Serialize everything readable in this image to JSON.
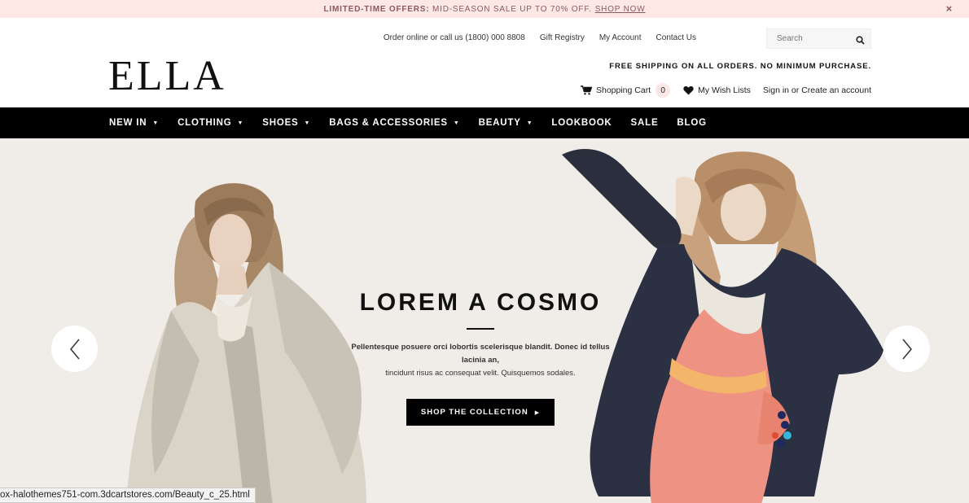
{
  "promo": {
    "label": "LIMITED-TIME OFFERS:",
    "text": "MID-SEASON SALE UP TO 70% OFF.",
    "link": "SHOP NOW",
    "close": "×"
  },
  "header": {
    "logo": "ELLA",
    "top_links": [
      "Order online or call us (1800) 000 8808",
      "Gift Registry",
      "My Account",
      "Contact Us"
    ],
    "search_placeholder": "Search",
    "free_shipping": "FREE SHIPPING ON ALL ORDERS. NO MINIMUM PURCHASE.",
    "cart_label": "Shopping Cart",
    "cart_count": "0",
    "wishlist_label": "My Wish Lists",
    "signin": "Sign in",
    "or": "or",
    "create_account": "Create an account"
  },
  "nav": {
    "items": [
      {
        "label": "NEW IN",
        "caret": true
      },
      {
        "label": "CLOTHING",
        "caret": true
      },
      {
        "label": "SHOES",
        "caret": true
      },
      {
        "label": "BAGS & ACCESSORIES",
        "caret": true
      },
      {
        "label": "BEAUTY",
        "caret": true
      },
      {
        "label": "LOOKBOOK",
        "caret": false
      },
      {
        "label": "SALE",
        "caret": false
      },
      {
        "label": "BLOG",
        "caret": false
      }
    ]
  },
  "hero": {
    "title": "LOREM A COSMO",
    "text_bold": "Pellentesque posuere orci lobortis scelerisque blandit. Donec id tellus lacinia an,",
    "text_line2": "tincidunt risus ac consequat velit. Quisquemos sodales.",
    "button": "SHOP THE COLLECTION"
  },
  "status_bar": {
    "url": "ox-halothemes751-com.3dcartstores.com/Beauty_c_25.html"
  },
  "colors": {
    "promo_bg": "#fde8e6",
    "nav_bg": "#000000",
    "hero_bg": "#f0ede8"
  }
}
